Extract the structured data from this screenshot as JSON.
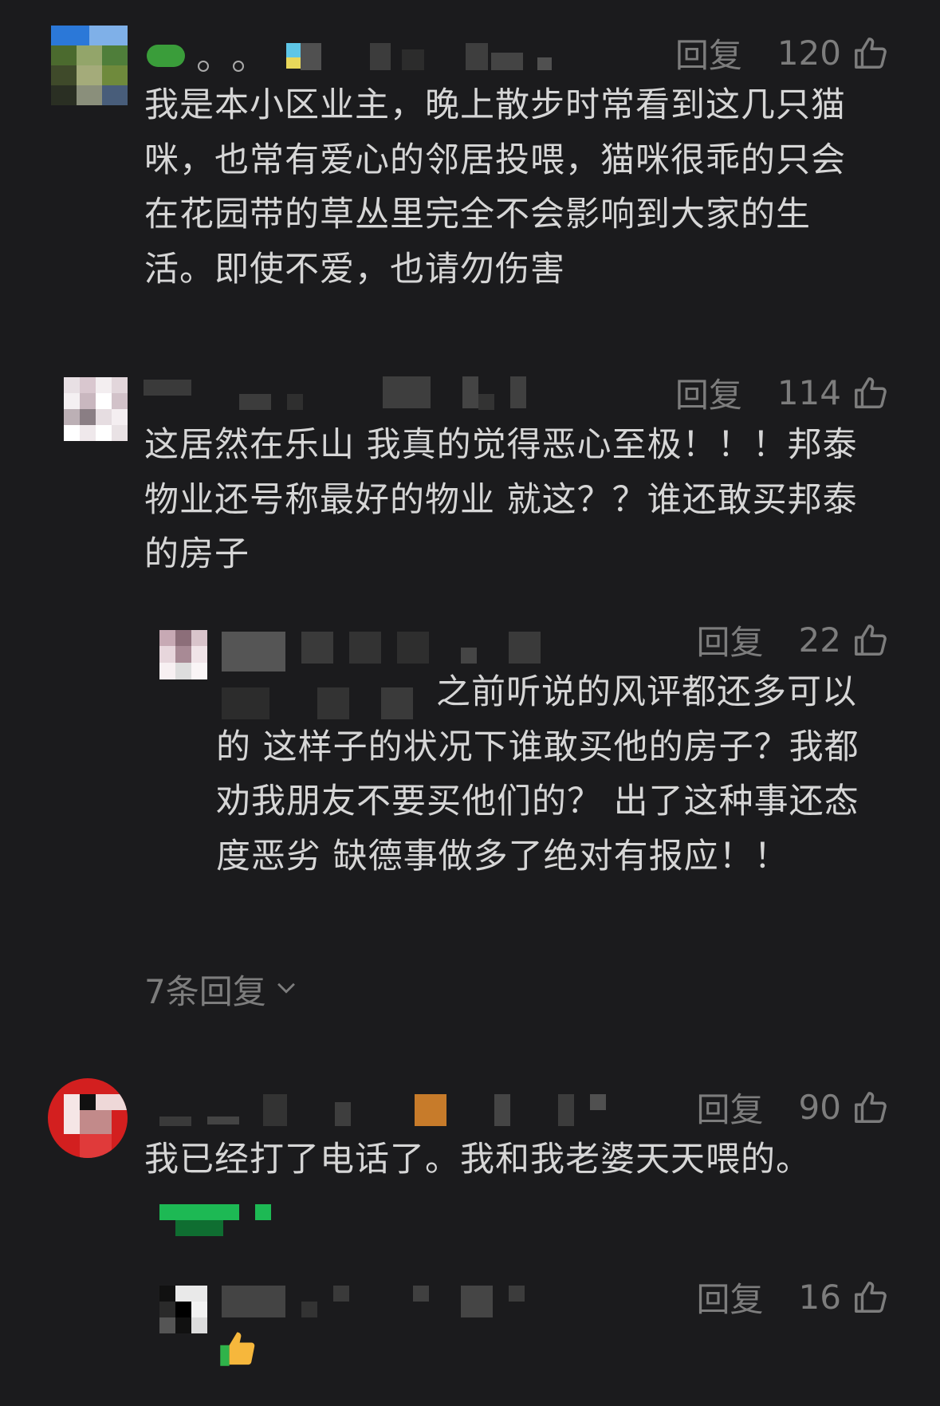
{
  "reply_label": "回复",
  "comments": [
    {
      "likes": "120",
      "text": "我是本小区业主，晚上散步时常看到这几只猫咪，也常有爱心的邻居投喂，猫咪很乖的只会在花园带的草丛里完全不会影响到大家的生活。即使不爱，也请勿伤害"
    },
    {
      "likes": "114",
      "text": "这居然在乐山 我真的觉得恶心至极！！！邦泰物业还号称最好的物业 就这？？谁还敢买邦泰的房子",
      "reply": {
        "likes": "22",
        "text": "之前听说的风评都还多可以的 这样子的状况下谁敢买他的房子？我都劝我朋友不要买他们的？ 出了这种事还态度恶劣  缺德事做多了绝对有报应！！"
      },
      "more_replies": "7条回复"
    },
    {
      "likes": "90",
      "text": "我已经打了电话了。我和我老婆天天喂的。",
      "reply": {
        "likes": "16",
        "emoji": "thumbs-up"
      }
    }
  ],
  "icons": {
    "like": "thumbs-up-outline-icon",
    "expand": "chevron-down-icon"
  },
  "colors": {
    "background": "#1b1b1d",
    "text": "#d6d6d6",
    "muted": "#7d7d7d"
  }
}
